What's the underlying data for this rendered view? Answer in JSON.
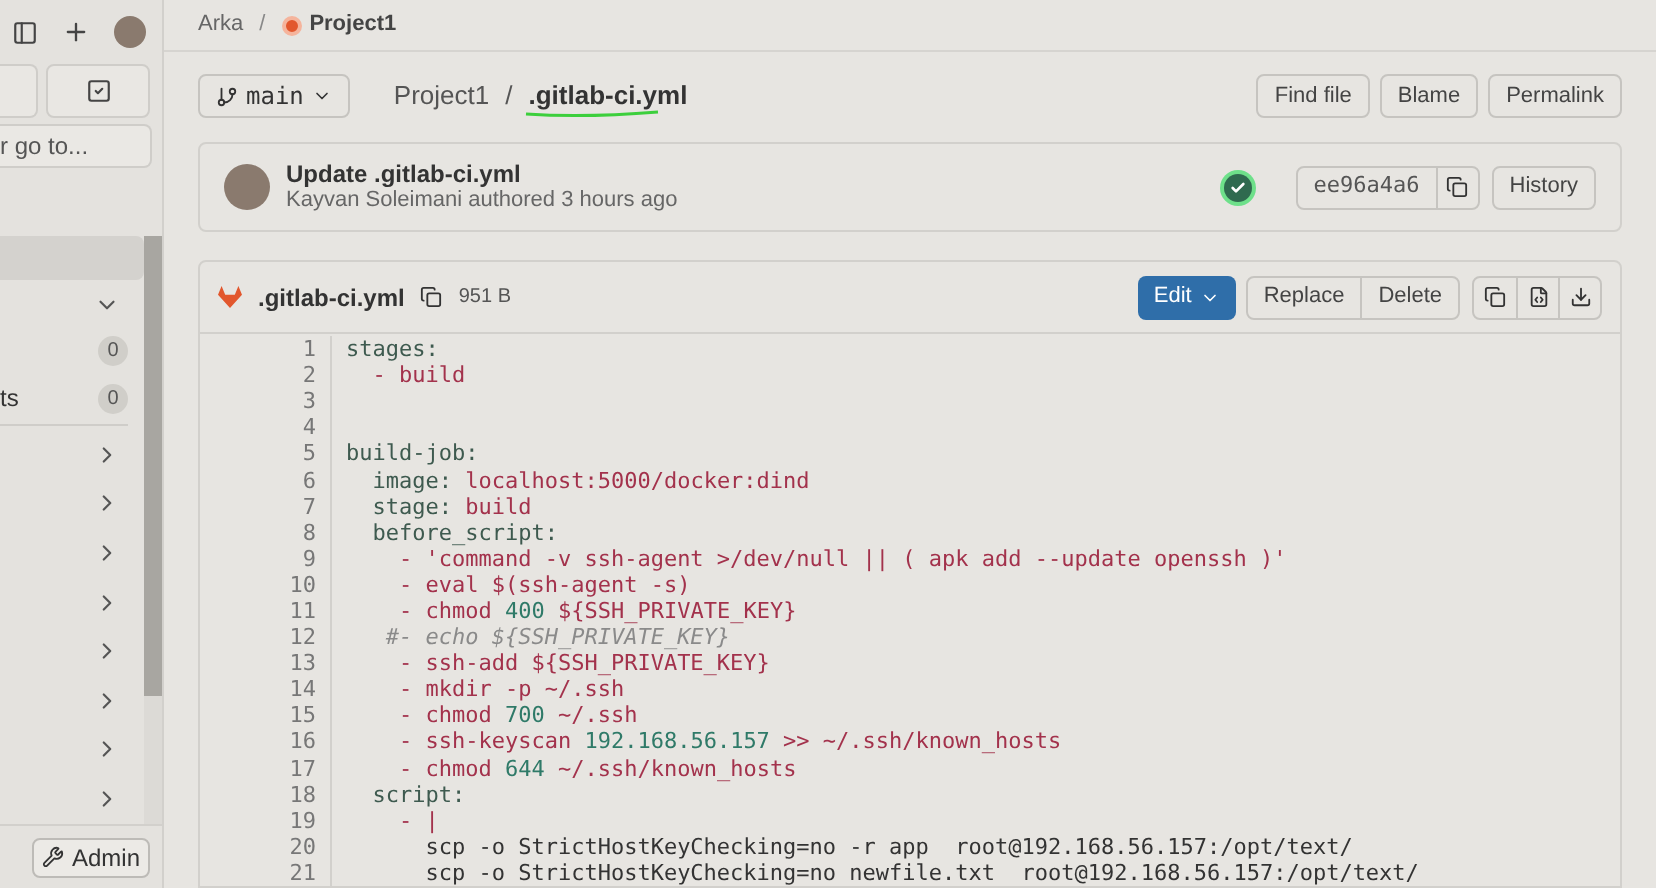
{
  "sidebar": {
    "search": {
      "placeholder": "r go to..."
    },
    "items": [
      {
        "kind": "highlight",
        "selected": true
      },
      {
        "kind": "section",
        "expanded": true
      },
      {
        "kind": "count",
        "count": "0"
      },
      {
        "kind": "count",
        "label": "ts",
        "count": "0"
      },
      {
        "kind": "section",
        "expanded": false
      },
      {
        "kind": "section",
        "expanded": false
      },
      {
        "kind": "section",
        "expanded": false
      },
      {
        "kind": "section",
        "expanded": false
      },
      {
        "kind": "section",
        "expanded": false
      },
      {
        "kind": "section",
        "expanded": false
      },
      {
        "kind": "section",
        "expanded": false
      },
      {
        "kind": "section",
        "expanded": false
      }
    ],
    "admin_button": "Admin"
  },
  "breadcrumb": [
    "Arka",
    "/",
    "Project1"
  ],
  "branch": "main",
  "path": [
    "Project1",
    "/",
    ".gitlab-ci.yml"
  ],
  "actions": [
    "Find file",
    "Blame",
    "Permalink"
  ],
  "commit": {
    "title": "Update .gitlab-ci.yml",
    "author": "Kayvan Soleimani authored 3 hours ago",
    "pipeline_passed": true,
    "sha": "ee96a4a6",
    "history": "History"
  },
  "file": {
    "name": ".gitlab-ci.yml",
    "size": "951 B",
    "edit": "Edit",
    "buttons": [
      "Replace",
      "Delete"
    ],
    "lines": [
      {
        "number": "1",
        "tokens": [
          {
            "text": "stages:",
            "kind": "key"
          }
        ]
      },
      {
        "number": "2",
        "tokens": [
          {
            "text": "  - build",
            "kind": "str"
          }
        ]
      },
      {
        "number": "3"
      },
      {
        "number": "4"
      },
      {
        "number": "5",
        "tokens": [
          {
            "text": "build-job:",
            "kind": "key"
          }
        ]
      },
      {
        "number": "6",
        "tokens": [
          {
            "text": "  image: ",
            "kind": "key"
          },
          {
            "text": "localhost:5000/docker:dind",
            "kind": "str"
          }
        ]
      },
      {
        "number": "7",
        "tokens": [
          {
            "text": "  stage: ",
            "kind": "key"
          },
          {
            "text": "build",
            "kind": "str"
          }
        ]
      },
      {
        "number": "8",
        "tokens": [
          {
            "text": "  before_script:",
            "kind": "key"
          }
        ]
      },
      {
        "number": "9",
        "tokens": [
          {
            "text": "    - 'command -v ssh-agent >/dev/null || ( apk add --update openssh )'",
            "kind": "str"
          }
        ]
      },
      {
        "number": "10",
        "tokens": [
          {
            "text": "    - eval $(ssh-agent -s)",
            "kind": "str"
          }
        ]
      },
      {
        "number": "11",
        "tokens": [
          {
            "text": "    - chmod ",
            "kind": "str"
          },
          {
            "text": "400",
            "kind": "num"
          },
          {
            "text": " ${SSH_PRIVATE_KEY}",
            "kind": "str"
          }
        ]
      },
      {
        "number": "12",
        "tokens": [
          {
            "text": "   #- echo ${SSH_PRIVATE_KEY}",
            "kind": "comment"
          }
        ]
      },
      {
        "number": "13",
        "tokens": [
          {
            "text": "    - ssh-add ${SSH_PRIVATE_KEY}",
            "kind": "str"
          }
        ]
      },
      {
        "number": "14",
        "tokens": [
          {
            "text": "    - mkdir -p ~/.ssh",
            "kind": "str"
          }
        ]
      },
      {
        "number": "15",
        "tokens": [
          {
            "text": "    - chmod ",
            "kind": "str"
          },
          {
            "text": "700",
            "kind": "num"
          },
          {
            "text": " ~/.ssh",
            "kind": "str"
          }
        ]
      },
      {
        "number": "16",
        "tokens": [
          {
            "text": "    - ssh-keyscan ",
            "kind": "str"
          },
          {
            "text": "192.168.56.157",
            "kind": "num"
          },
          {
            "text": " >> ~/.ssh/known_hosts",
            "kind": "str"
          }
        ]
      },
      {
        "number": "17",
        "tokens": [
          {
            "text": "    - chmod ",
            "kind": "str"
          },
          {
            "text": "644",
            "kind": "num"
          },
          {
            "text": " ~/.ssh/known_hosts",
            "kind": "str"
          }
        ]
      },
      {
        "number": "18",
        "tokens": [
          {
            "text": "  script:",
            "kind": "key"
          }
        ]
      },
      {
        "number": "19",
        "tokens": [
          {
            "text": "    - |",
            "kind": "str"
          }
        ]
      },
      {
        "number": "20",
        "tokens": [
          {
            "text": "      scp -o StrictHostKeyChecking=no -r app  root@192.168.56.157:/opt/text/",
            "kind": "plain"
          }
        ]
      },
      {
        "number": "21",
        "tokens": [
          {
            "text": "      scp -o StrictHostKeyChecking=no newfile.txt  root@192.168.56.157:/opt/text/",
            "kind": "plain"
          }
        ]
      }
    ]
  }
}
